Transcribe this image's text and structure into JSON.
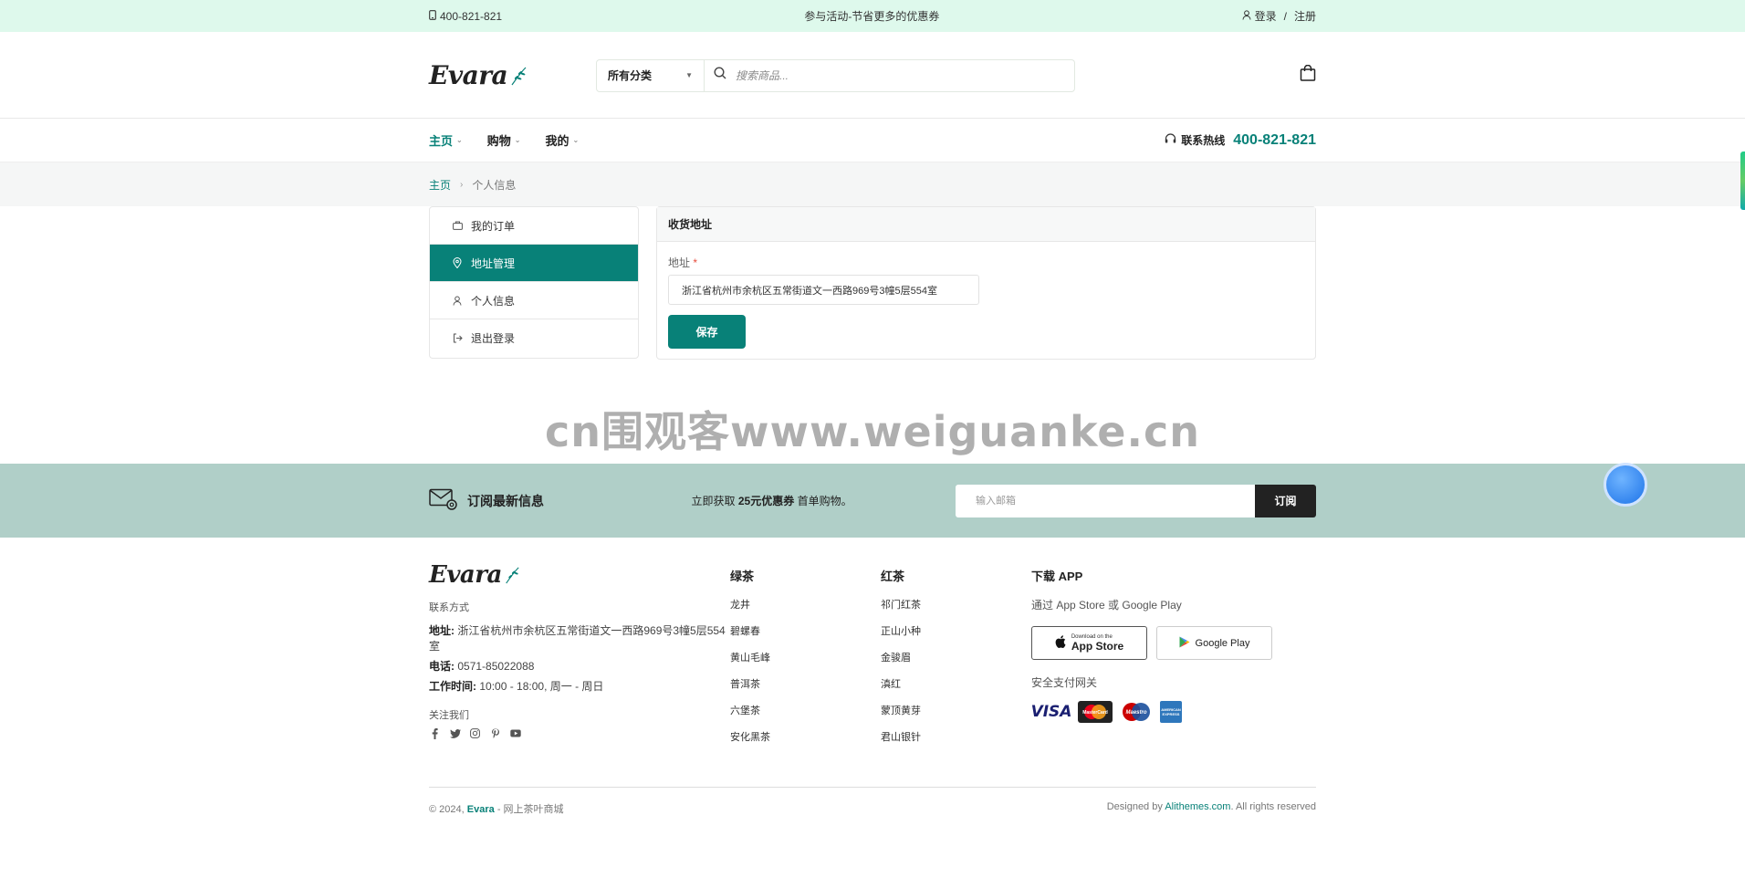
{
  "topbar": {
    "phone": "400-821-821",
    "promo": "参与活动-节省更多的优惠券",
    "login": "登录",
    "separator": "/",
    "register": "注册"
  },
  "header": {
    "logo": "Evara",
    "category": "所有分类",
    "search_placeholder": "搜索商品..."
  },
  "nav": {
    "items": [
      {
        "label": "主页",
        "active": true
      },
      {
        "label": "购物",
        "active": false
      },
      {
        "label": "我的",
        "active": false
      }
    ],
    "hotline_label": "联系热线",
    "hotline_number": "400-821-821"
  },
  "breadcrumb": {
    "home": "主页",
    "current": "个人信息"
  },
  "account": {
    "menu": [
      {
        "label": "我的订单",
        "icon": "bag-icon"
      },
      {
        "label": "地址管理",
        "icon": "location-pin-icon",
        "active": true
      },
      {
        "label": "个人信息",
        "icon": "user-icon"
      },
      {
        "label": "退出登录",
        "icon": "logout-icon"
      }
    ],
    "panel_title": "收货地址",
    "address_label": "地址",
    "address_required": "*",
    "address_value": "浙江省杭州市余杭区五常街道文一西路969号3幢5层554室",
    "save_label": "保存"
  },
  "watermark": "cn围观客www.weiguanke.cn",
  "newsletter": {
    "title": "订阅最新信息",
    "offer_prefix": "立即获取",
    "offer_highlight": "25元优惠券",
    "offer_suffix": "首单购物。",
    "email_placeholder": "输入邮箱",
    "subscribe_label": "订阅"
  },
  "footer": {
    "logo": "Evara",
    "contact_heading": "联系方式",
    "address_label": "地址:",
    "address_value": "浙江省杭州市余杭区五常街道文一西路969号3幢5层554室",
    "phone_label": "电话:",
    "phone_value": "0571-85022088",
    "hours_label": "工作时间:",
    "hours_value": "10:00 - 18:00, 周一 - 周日",
    "follow_heading": "关注我们",
    "green_tea": {
      "title": "绿茶",
      "items": [
        "龙井",
        "碧螺春",
        "黄山毛峰",
        "普洱茶",
        "六堡茶",
        "安化黑茶"
      ]
    },
    "black_tea": {
      "title": "红茶",
      "items": [
        "祁门红茶",
        "正山小种",
        "金骏眉",
        "滇红",
        "蒙顶黄芽",
        "君山银针"
      ]
    },
    "app_heading": "下载 APP",
    "app_sub": "通过 App Store 或 Google Play",
    "appstore_small": "Download on the",
    "appstore_big": "App Store",
    "googleplay": "Google Play",
    "payment_heading": "安全支付网关",
    "payment_cards": [
      "VISA",
      "MasterCard",
      "Maestro",
      "AMERICAN EXPRESS"
    ],
    "copyright_prefix": "© 2024,",
    "copyright_brand": "Evara",
    "copyright_suffix": "- 网上茶叶商城",
    "designed_prefix": "Designed by",
    "designed_link": "Alithemes.com",
    "designed_suffix": ". All rights reserved"
  },
  "colors": {
    "accent": "#088178",
    "topbar_bg": "#def9ec",
    "newsletter_bg": "#b0cfc8"
  }
}
